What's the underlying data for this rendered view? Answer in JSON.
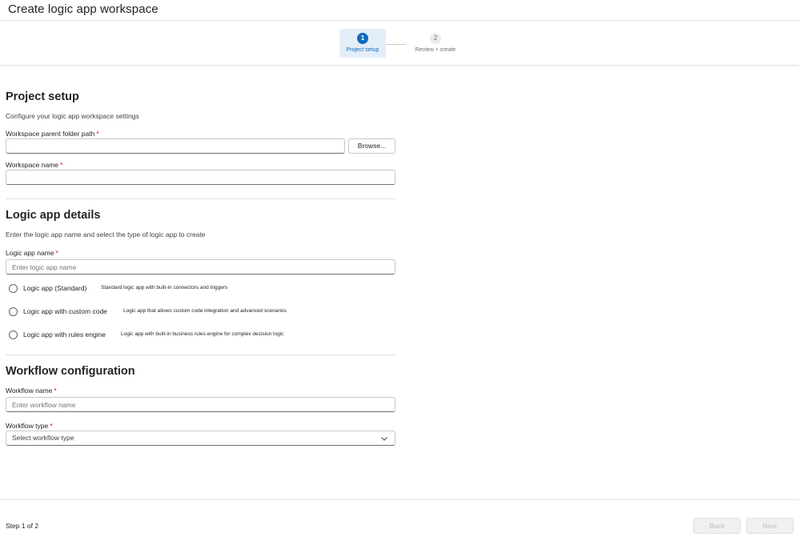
{
  "window": {
    "title": "Create logic app workspace"
  },
  "stepper": {
    "steps": [
      {
        "number": "1",
        "label": "Project setup",
        "state": "active"
      },
      {
        "number": "2",
        "label": "Review + create",
        "state": "inactive"
      }
    ]
  },
  "project_setup": {
    "title": "Project setup",
    "description": "Configure your logic app workspace settings",
    "folder_path": {
      "label": "Workspace parent folder path",
      "required_mark": "*",
      "value": "",
      "placeholder": ""
    },
    "browse_label": "Browse...",
    "workspace_name": {
      "label": "Workspace name",
      "required_mark": "*",
      "value": "",
      "placeholder": ""
    }
  },
  "logic_app_details": {
    "title": "Logic app details",
    "description": "Enter the logic app name and select the type of logic app to create",
    "app_name": {
      "label": "Logic app name",
      "required_mark": "*",
      "value": "",
      "placeholder": "Enter logic app name"
    },
    "app_types": [
      {
        "label": "Logic app (Standard)",
        "description": "Standard logic app with built-in connectors and triggers",
        "selected": false
      },
      {
        "label": "Logic app with custom code",
        "description": "Logic app that allows custom code integration and advanced scenarios",
        "selected": false
      },
      {
        "label": "Logic app with rules engine",
        "description": "Logic app with built-in business rules engine for complex decision logic",
        "selected": false
      }
    ]
  },
  "workflow_configuration": {
    "title": "Workflow configuration",
    "workflow_name": {
      "label": "Workflow name",
      "required_mark": "*",
      "value": "",
      "placeholder": "Enter workflow name"
    },
    "workflow_type": {
      "label": "Workflow type",
      "required_mark": "*",
      "selected": "Select workflow type"
    }
  },
  "footer": {
    "step_count": "Step 1 of 2",
    "back_label": "Back",
    "next_label": "Next"
  },
  "colors": {
    "accent": "#0f6cbd",
    "active_step_bg": "#e4eef9",
    "required": "#c50f1f",
    "disabled_button_bg": "#f0f0f0",
    "disabled_button_text": "#bdbdbd"
  },
  "icons": {
    "dropdown": "chevron-down-icon"
  }
}
